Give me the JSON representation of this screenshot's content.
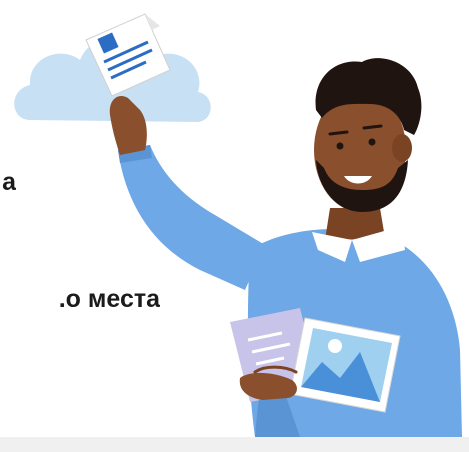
{
  "onboarding": {
    "text_line_1": "а",
    "text_line_2": "о места."
  },
  "colors": {
    "cloud": "#c7e0f4",
    "skin": "#8a4f2c",
    "hair": "#1f1410",
    "sweater": "#6ea8e6",
    "sweater_shadow": "#5a94d4",
    "collar": "#ffffff",
    "document_accent": "#2b6cc4",
    "lilac_doc": "#c8c3e8",
    "photo_sky": "#9fd0f0",
    "footer": "#f0f0f0"
  },
  "icons": [
    "cloud-icon",
    "document-icon",
    "photo-document-icon",
    "text-document-icon"
  ]
}
